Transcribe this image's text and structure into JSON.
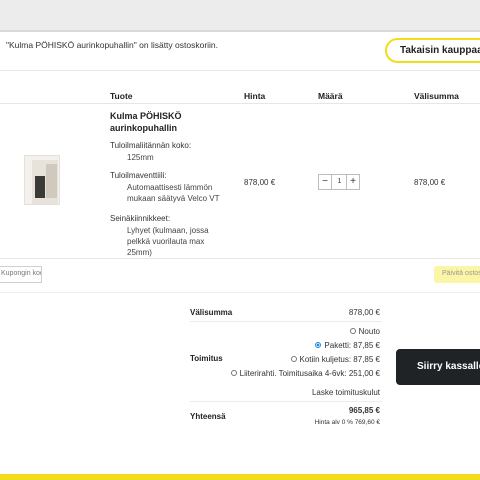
{
  "notice": {
    "message": "\"Kulma PÖHISKÖ aurinkopuhallin\" on lisätty ostoskoriin.",
    "back_button": "Takaisin kauppaan"
  },
  "cart": {
    "headers": {
      "product": "Tuote",
      "price": "Hinta",
      "quantity": "Määrä",
      "subtotal": "Välisumma"
    },
    "item": {
      "name": "Kulma PÖHISKÖ aurinkopuhallin",
      "attributes": [
        {
          "label": "Tuloilmaliitännän koko:",
          "value": "125mm"
        },
        {
          "label": "Tuloilmaventtiili:",
          "value": "Automaattisesti lämmön mukaan säätyvä Velco VT"
        },
        {
          "label": "Seinäkiinnikkeet:",
          "value": "Lyhyet (kulmaan, jossa pelkkä vuorilauta max 25mm)"
        }
      ],
      "price": "878,00 €",
      "quantity": "1",
      "subtotal": "878,00 €"
    },
    "coupon_placeholder": "Kupongin koodi",
    "update_button": "Päivitä ostoskori"
  },
  "totals": {
    "subtotal_label": "Välisumma",
    "subtotal_value": "878,00 €",
    "shipping_label": "Toimitus",
    "shipping_options": [
      {
        "label": "Nouto",
        "selected": false
      },
      {
        "label": "Paketti: 87,85 €",
        "selected": true
      },
      {
        "label": "Kotiin kuljetus: 87,85 €",
        "selected": false
      },
      {
        "label": "Liiterirahti. Toimitusaika 4-6vk: 251,00 €",
        "selected": false
      }
    ],
    "calc_shipping": "Laske toimituskulut",
    "total_label": "Yhteensä",
    "total_value": "965,85 €",
    "tax_note": "Hinta alv 0 % 769,60 €",
    "checkout_button": "Siirry kassalle"
  },
  "icons": {
    "minus": "minus-icon",
    "plus": "plus-icon",
    "radio": "radio-icon"
  },
  "colors": {
    "accent_yellow": "#f2dd1a",
    "checkout_dark": "#1f2326",
    "update_button_bg": "#fbf6a6",
    "radio_selected": "#1e88e5"
  }
}
